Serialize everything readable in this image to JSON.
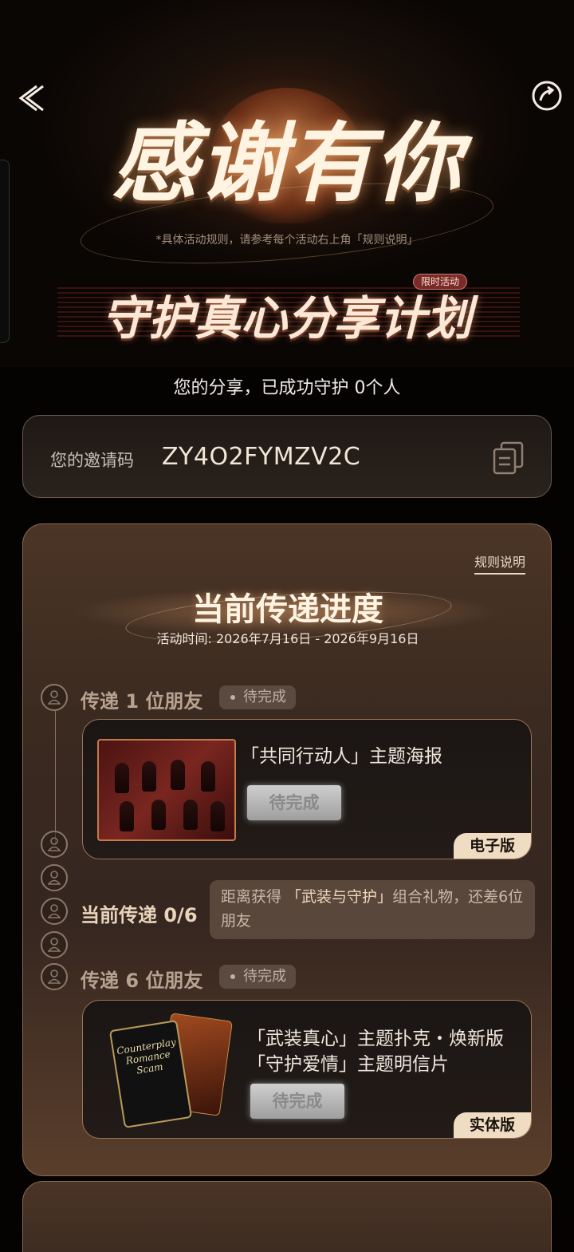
{
  "hero": {
    "title": "感谢有你",
    "note": "*具体活动规则，请参考每个活动右上角「规则说明」",
    "banner_title": "守护真心分享计划",
    "badge": "限时活动"
  },
  "summary": "您的分享，已成功守护 0个人",
  "invite": {
    "label": "您的邀请码",
    "code": "ZY4O2FYMZV2C"
  },
  "progress": {
    "rules_link": "规则说明",
    "title": "当前传递进度",
    "period": "活动时间: 2026年7月16日 - 2026年9月16日",
    "step1": {
      "label": "传递 1 位朋友",
      "status": "待完成",
      "reward_name": "「共同行动人」主题海报",
      "button": "待完成",
      "version": "电子版"
    },
    "current": {
      "label": "当前传递 0/6",
      "tip_prefix": "距离获得 ",
      "tip_highlight": "「武装与守护」",
      "tip_suffix": "组合礼物，还差6位朋友"
    },
    "step6": {
      "label": "传递 6 位朋友",
      "status": "待完成",
      "reward_line1": "「武装真心」主题扑克・焕新版",
      "reward_line2": "「守护爱情」主题明信片",
      "button": "待完成",
      "version": "实体版"
    }
  },
  "icons": {
    "back": "back-arrow-icon",
    "share": "share-icon",
    "copy": "copy-icon",
    "user": "user-icon"
  },
  "colors": {
    "accent": "#f0dcc2",
    "card_border": "#8a6a50",
    "pending_grey": "#9e9e9e"
  }
}
